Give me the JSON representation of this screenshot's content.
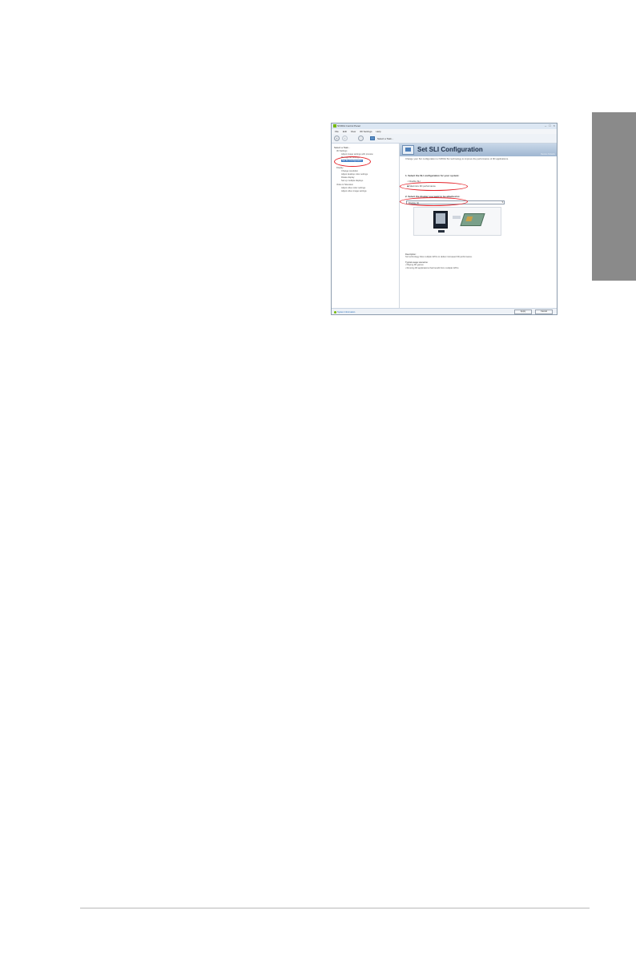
{
  "window": {
    "title": "NVIDIA Control Panel",
    "menu": [
      "File",
      "Edit",
      "View",
      "3D Settings",
      "Help"
    ],
    "toolbar": {
      "back": "‹",
      "forward": "›",
      "task_label": "Select a Task..."
    }
  },
  "left_pane": {
    "title": "Select a Task...",
    "items": [
      {
        "label": "3D Settings",
        "level": 0
      },
      {
        "label": "Adjust image settings with preview",
        "level": 1
      },
      {
        "label": "Manage 3D settings",
        "level": 1
      },
      {
        "label": "Set SLI Configuration",
        "level": 1,
        "selected": true
      },
      {
        "label": "Display",
        "level": 0
      },
      {
        "label": "Change resolution",
        "level": 1
      },
      {
        "label": "Adjust desktop color settings",
        "level": 1
      },
      {
        "label": "Rotate display",
        "level": 1
      },
      {
        "label": "Set up multiple displays",
        "level": 1
      },
      {
        "label": "Video & Television",
        "level": 0
      },
      {
        "label": "Adjust video color settings",
        "level": 1
      },
      {
        "label": "Adjust video image settings",
        "level": 1
      }
    ]
  },
  "main": {
    "banner_title": "Set SLI Configuration",
    "banner_link": "Restore Defaults",
    "description": "Change your SLI configuration to NVIDIA SLI technology to improve the performance of 3D applications.",
    "step1": "1. Select the SLI configuration for your system:",
    "options": [
      "Disable SLI",
      "Maximize 3D performance"
    ],
    "step2": "2. Select the display you want to be attached to:",
    "display_value": "Display [1]",
    "notes_title": "Description:",
    "notes": [
      "SLI technology links multiple GPUs to deliver increased 3D performance.",
      "Typical usage scenarios:",
      "• Playing 3D games",
      "• Running 3D applications that benefit from multiple GPUs"
    ]
  },
  "statusbar": {
    "system_info": "System Information",
    "apply": "Apply",
    "cancel": "Cancel"
  },
  "colors": {
    "highlight": "#e5232a",
    "nvidia_green": "#76b900",
    "side_tab": "#8a8a8a"
  }
}
